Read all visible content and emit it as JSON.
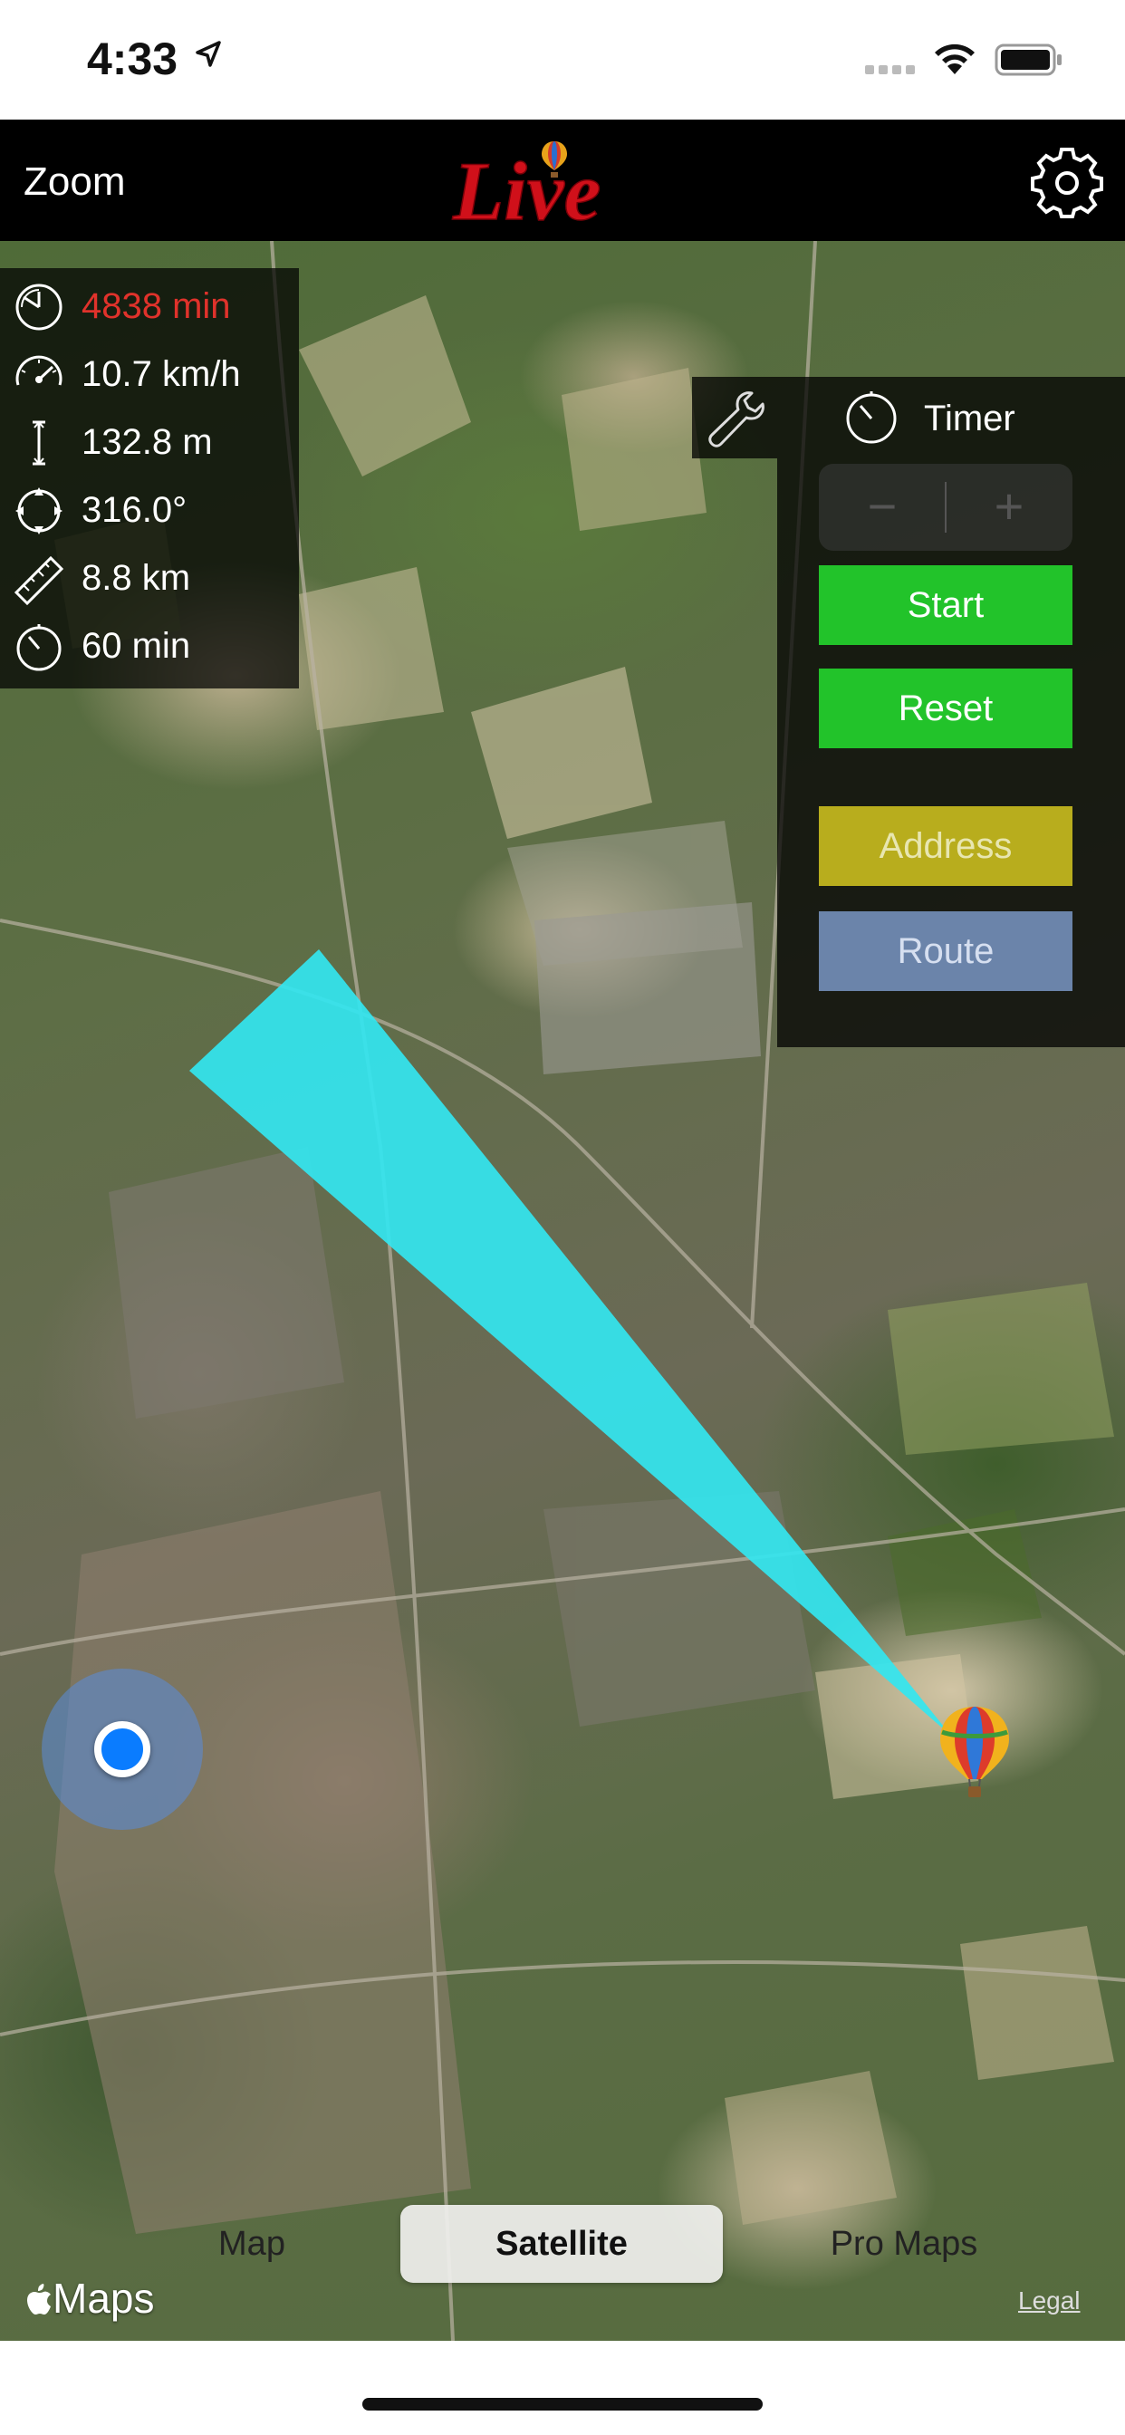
{
  "status_bar": {
    "time": "4:33",
    "location_icon": "location-arrow-icon",
    "signal_icon": "signal-icon",
    "wifi_icon": "wifi-icon",
    "battery_icon": "battery-icon"
  },
  "nav": {
    "zoom_label": "Zoom",
    "logo_text": "Live",
    "settings_icon": "gear-icon"
  },
  "stats": [
    {
      "icon": "clock-elapsed-icon",
      "value": "4838 min",
      "color": "#e0322b"
    },
    {
      "icon": "speedometer-icon",
      "value": "10.7 km/h",
      "color": "#ffffff"
    },
    {
      "icon": "altitude-icon",
      "value": "132.8 m",
      "color": "#ffffff"
    },
    {
      "icon": "heading-icon",
      "value": "316.0°",
      "color": "#ffffff"
    },
    {
      "icon": "ruler-icon",
      "value": "8.8 km",
      "color": "#ffffff"
    },
    {
      "icon": "timer-icon",
      "value": "60 min",
      "color": "#ffffff"
    }
  ],
  "timer_panel": {
    "tools_icon": "wrench-icon",
    "timer_icon": "stopwatch-icon",
    "timer_label": "Timer",
    "stepper": {
      "minus": "−",
      "plus": "+"
    },
    "buttons": {
      "start": "Start",
      "reset": "Reset",
      "address": "Address",
      "route": "Route"
    }
  },
  "map": {
    "type": "satellite",
    "balloon_icon": "hot-air-balloon-icon",
    "user_location_icon": "user-location-icon",
    "direction_cone_color": "#33e6f0"
  },
  "segmented_control": {
    "options": [
      "Map",
      "Satellite",
      "Pro Maps"
    ],
    "selected": "Satellite"
  },
  "footer": {
    "maps_brand": "Maps",
    "legal": "Legal"
  },
  "colors": {
    "start": "#22c32a",
    "reset": "#22c32a",
    "address": "#b8ad1d",
    "route": "#6b84aa",
    "logo_red": "#d0101a"
  }
}
